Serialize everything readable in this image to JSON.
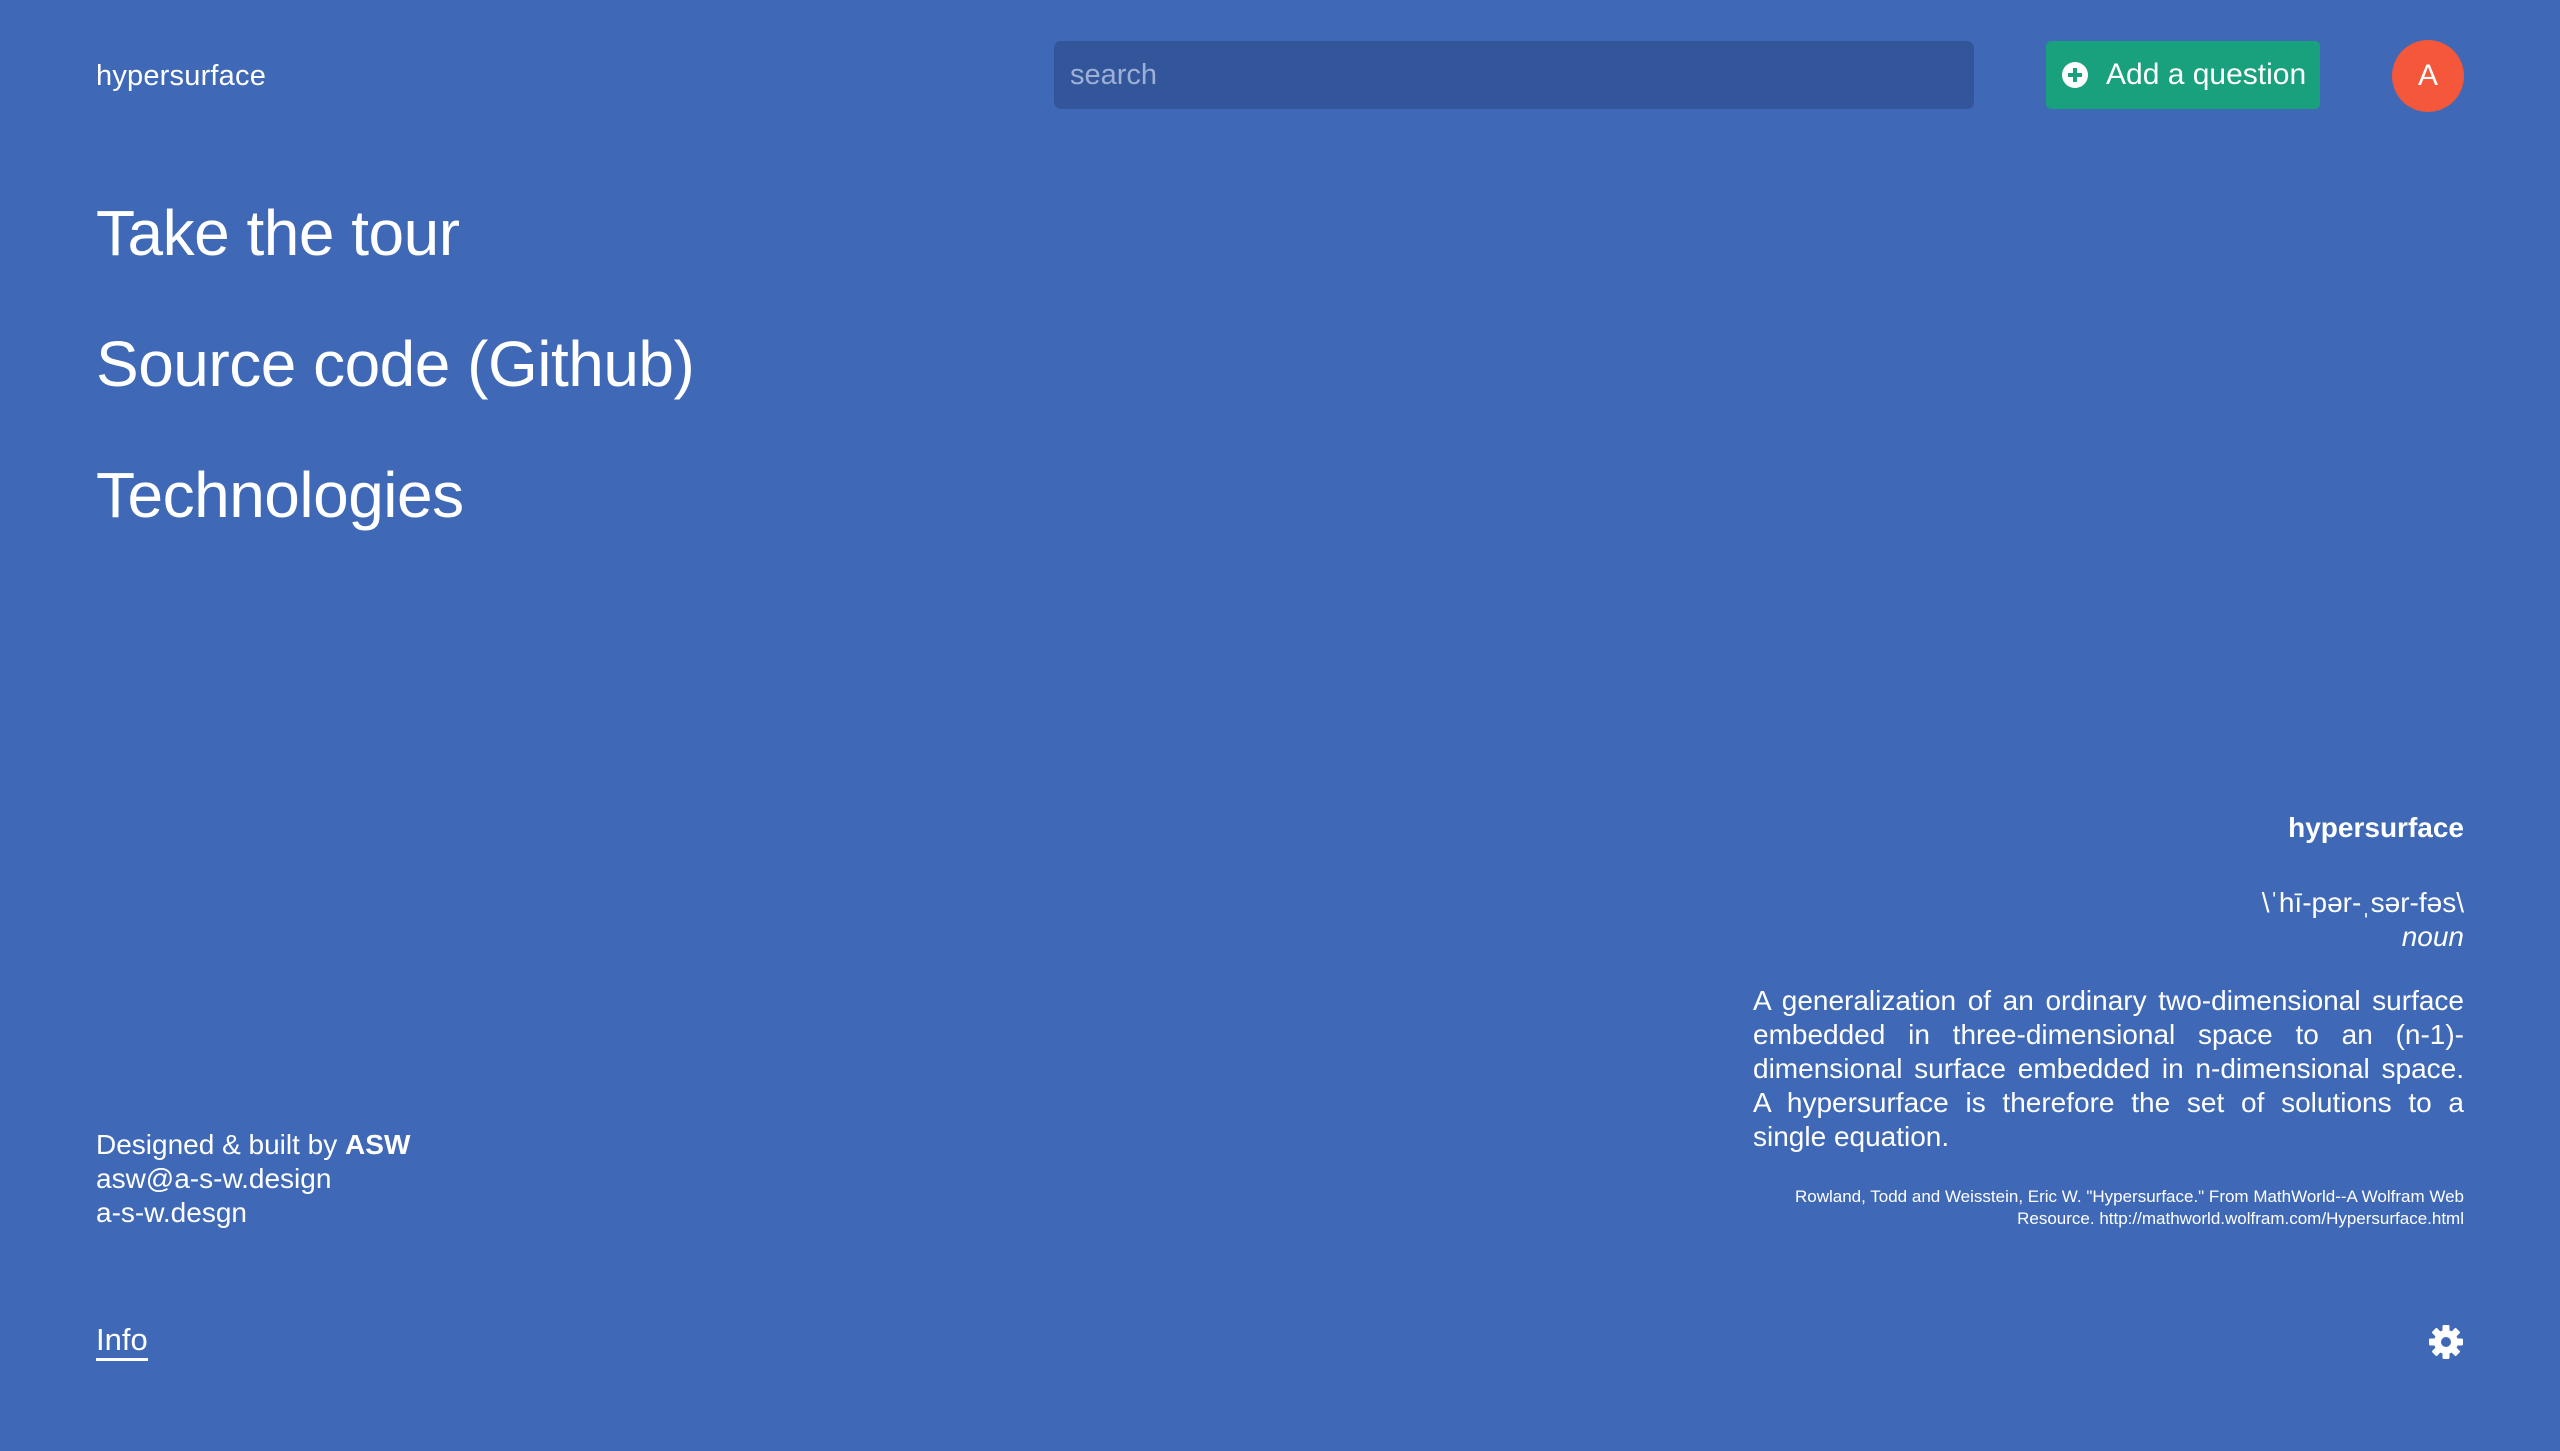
{
  "header": {
    "brand": "hypersurface",
    "search_placeholder": "search",
    "add_question_label": "Add a question",
    "avatar_initial": "A"
  },
  "nav": {
    "tour": "Take the tour",
    "source": "Source code (Github)",
    "technologies": "Technologies"
  },
  "credits": {
    "prefix": "Designed & built by ",
    "name": "ASW",
    "email": "asw@a-s-w.design",
    "site": "a-s-w.desgn"
  },
  "footer": {
    "info": "Info"
  },
  "definition": {
    "term": "hypersurface",
    "pronunciation": "\\ˈhī-pər-ˌsər-fəs\\",
    "part_of_speech": "noun",
    "text": "A generalization of an ordinary two-dimensional surface embedded in three-dimensional space to an (n-1)-dimensional surface embedded in n-dimensional space. A hypersurface is therefore the set of solutions to a single equation.",
    "citation": "Rowland, Todd and Weisstein, Eric W. \"Hypersurface.\" From MathWorld--A Wolfram Web Resource. http://mathworld.wolfram.com/Hypersurface.html"
  },
  "colors": {
    "background": "#3f69b6",
    "search_bg": "#33569a",
    "add_button": "#19a07c",
    "avatar": "#f4573a"
  },
  "icons": {
    "add": "plus-circle-icon",
    "settings": "gear-icon"
  }
}
